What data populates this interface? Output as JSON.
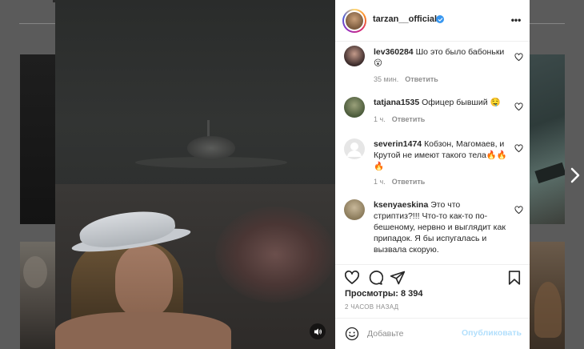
{
  "post": {
    "username": "tarzan__official",
    "verified": true,
    "more_label": "•••"
  },
  "comments": [
    {
      "user": "lev360284",
      "text": "Шо это было бабоньки 😮",
      "time": "35 мин.",
      "reply": "Ответить",
      "avatar_color": "#3a2a2a"
    },
    {
      "user": "tatjana1535",
      "text": "Офицер бывший 🤤",
      "time": "1 ч.",
      "reply": "Ответить",
      "avatar_color": "#4a5a3a"
    },
    {
      "user": "severin1474",
      "text": "Кобзон, Магомаев, и Крутой не имеют такого тела🔥🔥🔥",
      "time": "1 ч.",
      "reply": "Ответить",
      "avatar_color": "#e0e0e0"
    },
    {
      "user": "ksenyaeskina",
      "text": "Это что стриптиз?!!! Что-то как-то по-бешеному, нервно и выглядит как припадок. Я бы испугалась и вызвала скорую.",
      "time": "",
      "reply": "",
      "avatar_color": "#8a7a5a"
    }
  ],
  "stats": {
    "views": "Просмотры: 8 394",
    "time_ago": "2 ЧАСОВ НАЗАД"
  },
  "composer": {
    "placeholder": "Добавьте",
    "publish_label": "Опубликовать"
  },
  "icons": {
    "like": "heart-icon",
    "comment": "comment-icon",
    "share": "share-icon",
    "save": "bookmark-icon",
    "emoji": "emoji-icon",
    "mute": "speaker-icon",
    "next": "chevron-right-icon"
  },
  "colors": {
    "verified": "#3897f0",
    "publish_disabled": "#b2dffc"
  }
}
